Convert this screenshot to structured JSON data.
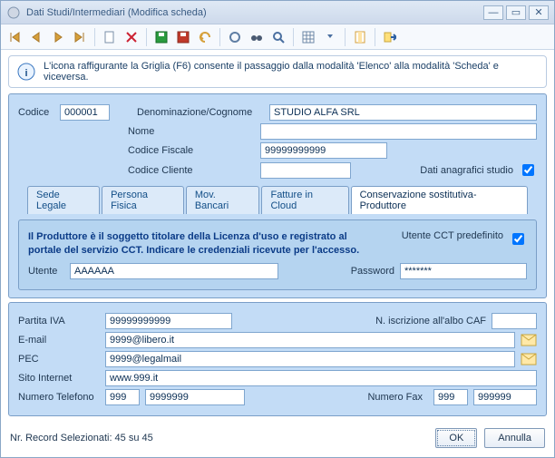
{
  "window": {
    "title": "Dati Studi/Intermediari (Modifica scheda)"
  },
  "info": {
    "text": "L'icona raffigurante la Griglia (F6) consente il passaggio dalla modalità 'Elenco' alla modalità 'Scheda' e viceversa."
  },
  "top": {
    "codice_label": "Codice",
    "codice": "000001",
    "denom_label": "Denominazione/Cognome",
    "denom": "STUDIO ALFA SRL",
    "nome_label": "Nome",
    "nome": "",
    "cf_label": "Codice Fiscale",
    "cf": "99999999999",
    "codcli_label": "Codice Cliente",
    "codcli": "",
    "anag_label": "Dati anagrafici studio"
  },
  "tabs": {
    "t1": "Sede Legale",
    "t2": "Persona Fisica",
    "t3": "Mov. Bancari",
    "t4": "Fatture in Cloud",
    "t5": "Conservazione sostitutiva-Produttore"
  },
  "prod": {
    "msg": "Il Produttore è il soggetto titolare della Licenza d'uso e registrato al portale del servizio CCT. Indicare le credenziali ricevute per l'accesso.",
    "predef_label": "Utente CCT predefinito",
    "utente_label": "Utente",
    "utente": "AAAAAA",
    "password_label": "Password",
    "password": "*******"
  },
  "bottom": {
    "piva_label": "Partita IVA",
    "piva": "99999999999",
    "iscr_label": "N. iscrizione all'albo CAF",
    "iscr": "",
    "email_label": "E-mail",
    "email": "9999@libero.it",
    "pec_label": "PEC",
    "pec": "9999@legalmail",
    "sito_label": "Sito Internet",
    "sito": "www.999.it",
    "tel_label": "Numero Telefono",
    "tel_pref": "999",
    "tel_num": "9999999",
    "fax_label": "Numero Fax",
    "fax_pref": "999",
    "fax_num": "999999"
  },
  "footer": {
    "records": "Nr. Record Selezionati: 45 su 45",
    "ok": "OK",
    "annulla": "Annulla"
  }
}
